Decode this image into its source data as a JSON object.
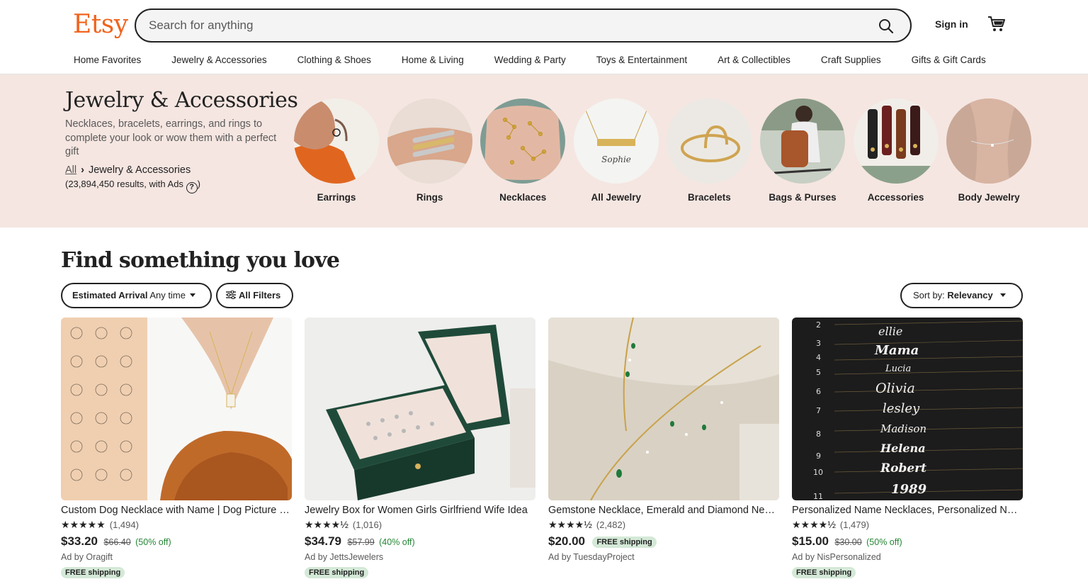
{
  "header": {
    "logo": "Etsy",
    "search_placeholder": "Search for anything",
    "sign_in": "Sign in"
  },
  "nav": [
    "Home Favorites",
    "Jewelry & Accessories",
    "Clothing & Shoes",
    "Home & Living",
    "Wedding & Party",
    "Toys & Entertainment",
    "Art & Collectibles",
    "Craft Supplies",
    "Gifts & Gift Cards"
  ],
  "category": {
    "title": "Jewelry & Accessories",
    "description": "Necklaces, bracelets, earrings, and rings to complete your look or wow them with a perfect gift",
    "breadcrumb_all": "All",
    "breadcrumb_current": "Jewelry & Accessories",
    "results": "(23,894,450 results, with Ads",
    "results_close": ")",
    "subcategories": [
      "Earrings",
      "Rings",
      "Necklaces",
      "All Jewelry",
      "Bracelets",
      "Bags & Purses",
      "Accessories",
      "Body Jewelry"
    ]
  },
  "main": {
    "heading": "Find something you love",
    "filter_arrival_label": "Estimated Arrival",
    "filter_arrival_value": "Any time",
    "all_filters": "All Filters",
    "sort_label": "Sort by:",
    "sort_value": "Relevancy"
  },
  "listings": [
    {
      "title": "Custom Dog Necklace with Name | Dog Picture Necklace",
      "rating": 5,
      "stars": "★★★★★",
      "reviews": "(1,494)",
      "price": "$33.20",
      "was": "$66.40",
      "off": "(50% off)",
      "ad": "Ad by Oragift",
      "free_shipping": "FREE shipping"
    },
    {
      "title": "Jewelry Box for Women Girls Girlfriend Wife Idea",
      "rating": 4.5,
      "stars": "★★★★½",
      "reviews": "(1,016)",
      "price": "$34.79",
      "was": "$57.99",
      "off": "(40% off)",
      "ad": "Ad by JettsJewelers",
      "free_shipping": "FREE shipping"
    },
    {
      "title": "Gemstone Necklace, Emerald and Diamond Necklace",
      "rating": 4.5,
      "stars": "★★★★½",
      "reviews": "(2,482)",
      "price": "$20.00",
      "was": "",
      "off": "",
      "ad": "Ad by TuesdayProject",
      "free_shipping": "FREE shipping"
    },
    {
      "title": "Personalized Name Necklaces, Personalized Name Jewelry",
      "rating": 4.5,
      "stars": "★★★★½",
      "reviews": "(1,479)",
      "price": "$15.00",
      "was": "$30.00",
      "off": "(50% off)",
      "ad": "Ad by NisPersonalized",
      "free_shipping": "FREE shipping"
    }
  ],
  "colors": {
    "brand": "#f1641e",
    "banner": "#f5e6e1",
    "sale_green": "#258635",
    "badge_bg": "#d4e9d7"
  }
}
